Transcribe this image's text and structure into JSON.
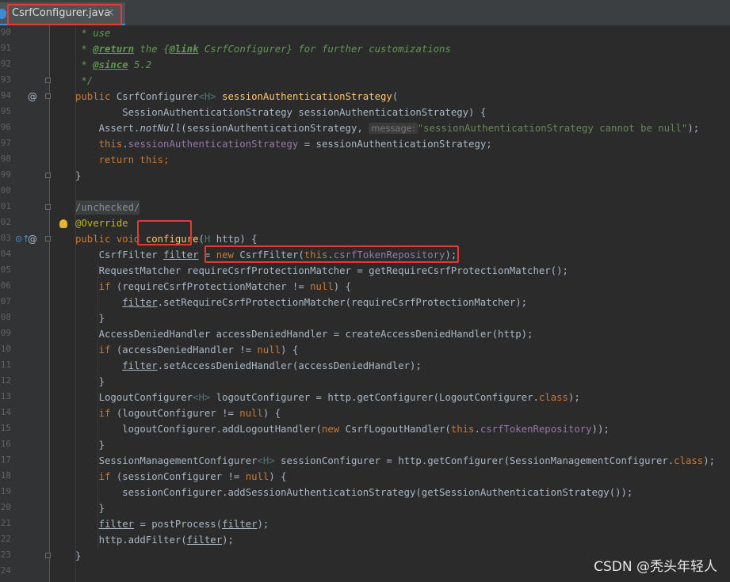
{
  "tab": {
    "file_name": "CsrfConfigurer.java",
    "close_glyph": "×"
  },
  "gutter": {
    "line_numbers": [
      "90",
      "91",
      "92",
      "93",
      "94",
      "95",
      "96",
      "97",
      "98",
      "99",
      "00",
      "01",
      "02",
      "03",
      "04",
      "05",
      "06",
      "07",
      "08",
      "09",
      "10",
      "11",
      "12",
      "13",
      "14",
      "15",
      "16",
      "17",
      "18",
      "19",
      "20",
      "21",
      "22",
      "23",
      "24"
    ],
    "override_glyph": "@",
    "implements_glyph": "⊙↑"
  },
  "code": {
    "l90": " * use",
    "l91_a": " * ",
    "l91_tag": "@return",
    "l91_b": " the {",
    "l91_link": "@link",
    "l91_c": " CsrfConfigurer} for further customizations",
    "l92_a": " * ",
    "l92_tag": "@since",
    "l92_b": " 5.2",
    "l93": " */",
    "l94_kw": "public ",
    "l94_type": "CsrfConfigurer",
    "l94_gen": "<H>",
    "l94_sp": " ",
    "l94_mth": "sessionAuthenticationStrategy",
    "l94_par": "(",
    "l95": "        SessionAuthenticationStrategy sessionAuthenticationStrategy) {",
    "l96_a": "    Assert.",
    "l96_call": "notNull",
    "l96_b": "(sessionAuthenticationStrategy, ",
    "l96_hint": "message:",
    "l96_str": "\"sessionAuthenticationStrategy cannot be null\"",
    "l96_end": ");",
    "l97_kw": "    this",
    "l97_dot": ".",
    "l97_fld": "sessionAuthenticationStrategy",
    "l97_rest": " = sessionAuthenticationStrategy;",
    "l98_kw": "    return this",
    "l98_end": ";",
    "l99": "}",
    "l01": "/unchecked/",
    "l02": "@Override",
    "l03_kw": "public void ",
    "l03_mth": "configure",
    "l03_par": "(",
    "l03_gen": "H",
    "l03_rest": " http) {",
    "l04_a": "    CsrfFilter ",
    "l04_var": "filter",
    "l04_b": " = ",
    "l04_kw": "new",
    "l04_c": " CsrfFilter(",
    "l04_this": "this",
    "l04_dot": ".",
    "l04_fld": "csrfTokenRepository",
    "l04_end": ");",
    "l05": "    RequestMatcher requireCsrfProtectionMatcher = getRequireCsrfProtectionMatcher();",
    "l06_kw": "    if",
    "l06_a": " (requireCsrfProtectionMatcher != ",
    "l06_null": "null",
    "l06_b": ") {",
    "l07_sp": "        ",
    "l07_var": "filter",
    "l07_rest": ".setRequireCsrfProtectionMatcher(requireCsrfProtectionMatcher);",
    "l08": "    }",
    "l09": "    AccessDeniedHandler accessDeniedHandler = createAccessDeniedHandler(http);",
    "l10_kw": "    if",
    "l10_a": " (accessDeniedHandler != ",
    "l10_null": "null",
    "l10_b": ") {",
    "l11_sp": "        ",
    "l11_var": "filter",
    "l11_rest": ".setAccessDeniedHandler(accessDeniedHandler);",
    "l12": "    }",
    "l13_a": "    LogoutConfigurer",
    "l13_gen": "<H>",
    "l13_b": " logoutConfigurer = http.getConfigurer(LogoutConfigurer.",
    "l13_kw": "class",
    "l13_end": ");",
    "l14_kw": "    if",
    "l14_a": " (logoutConfigurer != ",
    "l14_null": "null",
    "l14_b": ") {",
    "l15_a": "        logoutConfigurer.addLogoutHandler(",
    "l15_kw": "new",
    "l15_b": " CsrfLogoutHandler(",
    "l15_this": "this",
    "l15_dot": ".",
    "l15_fld": "csrfTokenRepository",
    "l15_end": "));",
    "l16": "    }",
    "l17_a": "    SessionManagementConfigurer",
    "l17_gen": "<H>",
    "l17_b": " sessionConfigurer = http.getConfigurer(SessionManagementConfigurer.",
    "l17_kw": "class",
    "l17_end": ");",
    "l18_kw": "    if",
    "l18_a": " (sessionConfigurer != ",
    "l18_null": "null",
    "l18_b": ") {",
    "l19": "        sessionConfigurer.addSessionAuthenticationStrategy(getSessionAuthenticationStrategy());",
    "l20": "    }",
    "l21_sp": "    ",
    "l21_var": "filter",
    "l21_a": " = postProcess(",
    "l21_var2": "filter",
    "l21_end": ");",
    "l22_a": "    http.addFilter(",
    "l22_var": "filter",
    "l22_end": ");",
    "l23": "}"
  },
  "watermark": "CSDN @秃头年轻人"
}
